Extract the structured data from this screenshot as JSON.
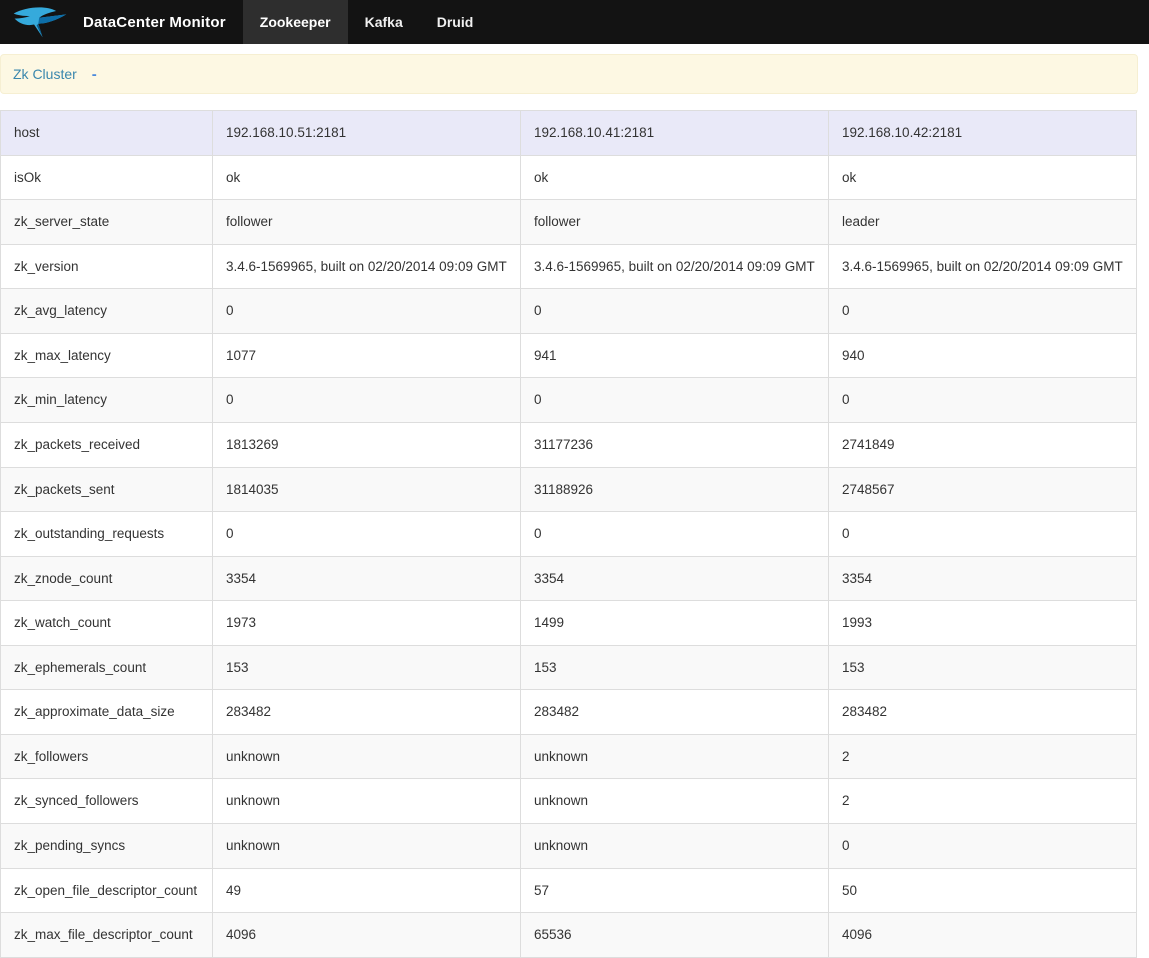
{
  "navbar": {
    "brand": "DataCenter Monitor",
    "logo": "swallow-bird-logo",
    "items": [
      {
        "id": "zookeeper",
        "label": "Zookeeper",
        "active": true
      },
      {
        "id": "kafka",
        "label": "Kafka",
        "active": false
      },
      {
        "id": "druid",
        "label": "Druid",
        "active": false
      }
    ]
  },
  "panel": {
    "title": "Zk Cluster",
    "collapse_label": "-"
  },
  "table": {
    "rows": [
      {
        "metric": "host",
        "values": [
          "192.168.10.51:2181",
          "192.168.10.41:2181",
          "192.168.10.42:2181"
        ]
      },
      {
        "metric": "isOk",
        "values": [
          "ok",
          "ok",
          "ok"
        ]
      },
      {
        "metric": "zk_server_state",
        "values": [
          "follower",
          "follower",
          "leader"
        ]
      },
      {
        "metric": "zk_version",
        "values": [
          "3.4.6-1569965, built on 02/20/2014 09:09 GMT",
          "3.4.6-1569965, built on 02/20/2014 09:09 GMT",
          "3.4.6-1569965, built on 02/20/2014 09:09 GMT"
        ]
      },
      {
        "metric": "zk_avg_latency",
        "values": [
          "0",
          "0",
          "0"
        ]
      },
      {
        "metric": "zk_max_latency",
        "values": [
          "1077",
          "941",
          "940"
        ]
      },
      {
        "metric": "zk_min_latency",
        "values": [
          "0",
          "0",
          "0"
        ]
      },
      {
        "metric": "zk_packets_received",
        "values": [
          "1813269",
          "31177236",
          "2741849"
        ]
      },
      {
        "metric": "zk_packets_sent",
        "values": [
          "1814035",
          "31188926",
          "2748567"
        ]
      },
      {
        "metric": "zk_outstanding_requests",
        "values": [
          "0",
          "0",
          "0"
        ]
      },
      {
        "metric": "zk_znode_count",
        "values": [
          "3354",
          "3354",
          "3354"
        ]
      },
      {
        "metric": "zk_watch_count",
        "values": [
          "1973",
          "1499",
          "1993"
        ]
      },
      {
        "metric": "zk_ephemerals_count",
        "values": [
          "153",
          "153",
          "153"
        ]
      },
      {
        "metric": "zk_approximate_data_size",
        "values": [
          "283482",
          "283482",
          "283482"
        ]
      },
      {
        "metric": "zk_followers",
        "values": [
          "unknown",
          "unknown",
          "2"
        ]
      },
      {
        "metric": "zk_synced_followers",
        "values": [
          "unknown",
          "unknown",
          "2"
        ]
      },
      {
        "metric": "zk_pending_syncs",
        "values": [
          "unknown",
          "unknown",
          "0"
        ]
      },
      {
        "metric": "zk_open_file_descriptor_count",
        "values": [
          "49",
          "57",
          "50"
        ]
      },
      {
        "metric": "zk_max_file_descriptor_count",
        "values": [
          "4096",
          "65536",
          "4096"
        ]
      }
    ]
  },
  "colors": {
    "navbar_bg": "#131313",
    "active_tab_bg": "#2e2e2e",
    "panel_bg": "#fdf8e3",
    "panel_title": "#3a87ad",
    "collapse_link": "#4a89dc",
    "logo_blue": "#35aadc",
    "logo_dark_blue": "#0d6ea8",
    "table_border": "#dddddd",
    "stripe_row_bg": "#f9f9f9",
    "host_row_bg": "#e9e9f8"
  }
}
